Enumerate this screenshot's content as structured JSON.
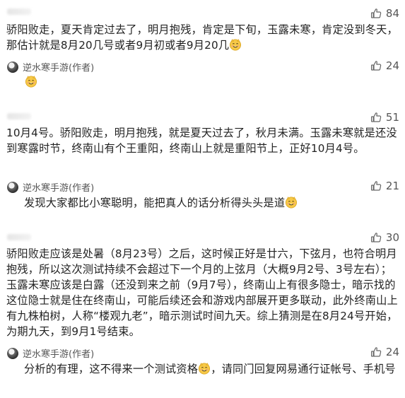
{
  "comments": [
    {
      "likes": "84",
      "text": "骄阳败走，夏天肯定过去了，明月抱残，肯定是下旬，玉露未寒，肯定没到冬天，那估计就是8月20几号或者9月初或者9月20几",
      "reply": {
        "author": "逆水寒手游(作者)",
        "likes": "24",
        "text": ""
      }
    },
    {
      "likes": "51",
      "text": "10月4号。骄阳败走，明月抱残，就是夏天过去了，秋月未满。玉露未寒就是还没到寒露时节，终南山有个王重阳，终南山上就是重阳节上，正好10月4号。",
      "reply": {
        "author": "逆水寒手游(作者)",
        "likes": "21",
        "text": "发现大家都比小寒聪明，能把真人的话分析得头头是道"
      }
    },
    {
      "likes": "30",
      "text": "骄阳败走应该是处暑（8月23号）之后，这时候正好是廿六，下弦月，也符合明月抱残，所以这次测试持续不会超过下一个月的上弦月（大概9月2号、3号左右）；玉露未寒应该是白露（还没到来之前（9月7号），终南山上有很多隐士，暗示找的这位隐士就是住在终南山，可能后续还会和游戏内部展开更多联动，此外终南山上有九株柏树，人称“楼观九老”，暗示测试时间九天。综上猜测是在8月24号开始，为期九天，到9月1号结束。",
      "reply": {
        "author": "逆水寒手游(作者)",
        "likes": "24",
        "text": "分析的有理，这不得来一个测试资格",
        "text_after": "，请同门回复网易通行证帐号、手机号"
      }
    }
  ],
  "icons": {
    "like": "thumbs-up-icon",
    "emoji": "grinning-face-emoji-icon"
  },
  "colors": {
    "text": "#222222",
    "muted": "#555555",
    "icon": "#666666"
  }
}
